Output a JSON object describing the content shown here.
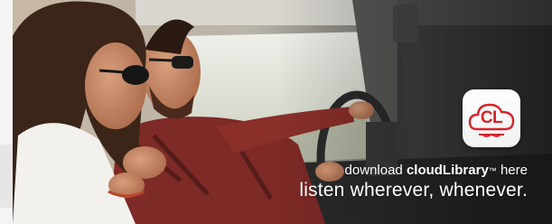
{
  "banner": {
    "app_icon": {
      "icon_name": "cloudlibrary-app-icon",
      "letters": "CL",
      "brand_color": "#d6232a"
    },
    "tagline": {
      "prefix": "download ",
      "brand": "cloudLibrary",
      "trademark": "™",
      "suffix": " here",
      "slogan": "listen wherever, whenever."
    }
  }
}
